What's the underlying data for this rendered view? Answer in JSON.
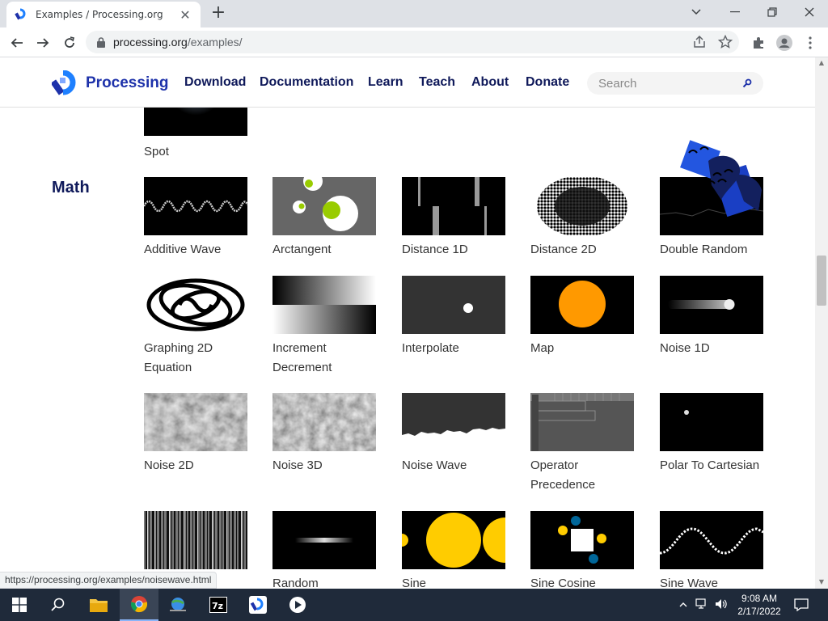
{
  "browser": {
    "tab_title": "Examples / Processing.org",
    "url_host": "processing.org",
    "url_path": "/examples/",
    "status_url": "https://processing.org/examples/noisewave.html"
  },
  "site": {
    "logo_text": "Processing",
    "nav": [
      "Download",
      "Documentation",
      "Learn",
      "Teach",
      "About",
      "Donate"
    ],
    "search_placeholder": "Search"
  },
  "content": {
    "section_title": "Math",
    "previous_item": "Spot",
    "rows": [
      [
        "Additive Wave",
        "Arctangent",
        "Distance 1D",
        "Distance 2D",
        "Double Random"
      ],
      [
        "Graphing 2D Equation",
        "Increment Decrement",
        "Interpolate",
        "Map",
        "Noise 1D"
      ],
      [
        "Noise 2D",
        "Noise 3D",
        "Noise Wave",
        "Operator Precedence",
        "Polar To Cartesian"
      ],
      [
        "Random",
        "Sine",
        "Sine Cosine",
        "Sine Wave"
      ]
    ]
  },
  "taskbar": {
    "time": "9:08 AM",
    "date": "2/17/2022",
    "apps": [
      "start",
      "search",
      "file-explorer",
      "chrome",
      "network-app",
      "7zip",
      "processing",
      "media-player"
    ]
  },
  "colors": {
    "brand_blue": "#1e32aa",
    "nav_text": "#0f195a",
    "taskbar": "#1f2a3a"
  }
}
